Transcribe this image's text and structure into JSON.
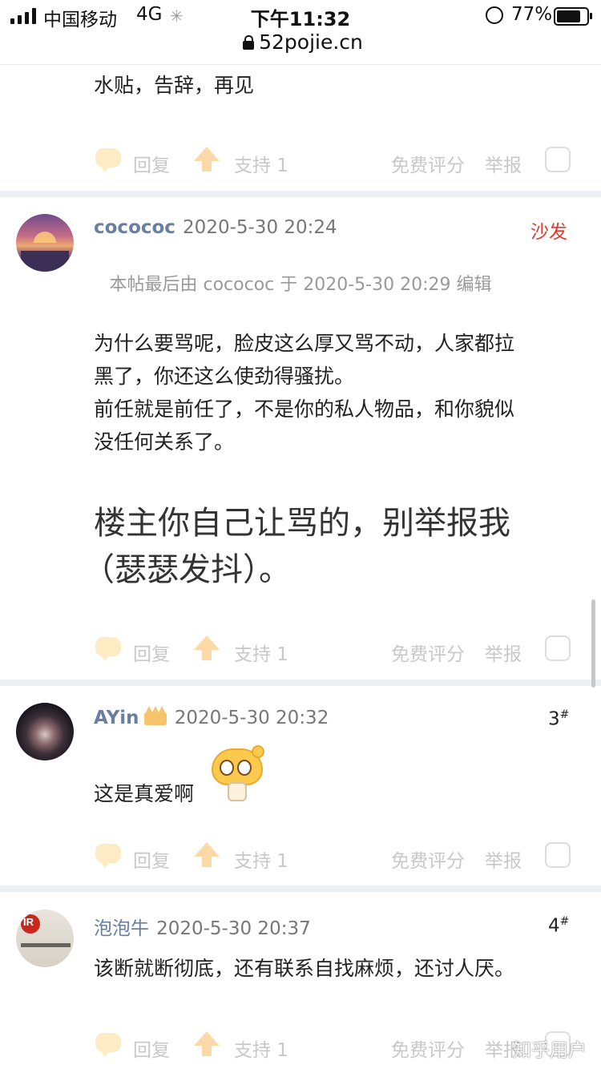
{
  "status_bar": {
    "carrier": "中国移动",
    "network": "4G",
    "time": "下午11:32",
    "battery": "77%",
    "url": "52pojie.cn"
  },
  "actions": {
    "reply": "回复",
    "support": "支持 1",
    "rate": "免费评分",
    "report": "举报"
  },
  "posts": [
    {
      "body": "水贴，告辞，再见"
    },
    {
      "username": "cocococ",
      "time": "2020-5-30 20:24",
      "floor": "沙发",
      "edit_note": "本帖最后由 cocococ 于 2020-5-30 20:29 编辑",
      "body_lines": [
        "为什么要骂呢，脸皮这么厚又骂不动，人家都拉",
        "黑了，你还这么使劲得骚扰。",
        "前任就是前任了，不是你的私人物品，和你貌似",
        "没任何关系了。"
      ],
      "big_lines": [
        "楼主你自己让骂的，别举报我",
        "（瑟瑟发抖）。"
      ]
    },
    {
      "username": "AYin",
      "time": "2020-5-30 20:32",
      "floor": "3",
      "floor_mark": "#",
      "body": "这是真爱啊"
    },
    {
      "username": "泡泡牛",
      "time": "2020-5-30 20:37",
      "floor": "4",
      "floor_mark": "#",
      "body": "该断就断彻底，还有联系自找麻烦，还讨人厌。",
      "avatar_text": "IR"
    }
  ],
  "watermark": "知乎用户"
}
